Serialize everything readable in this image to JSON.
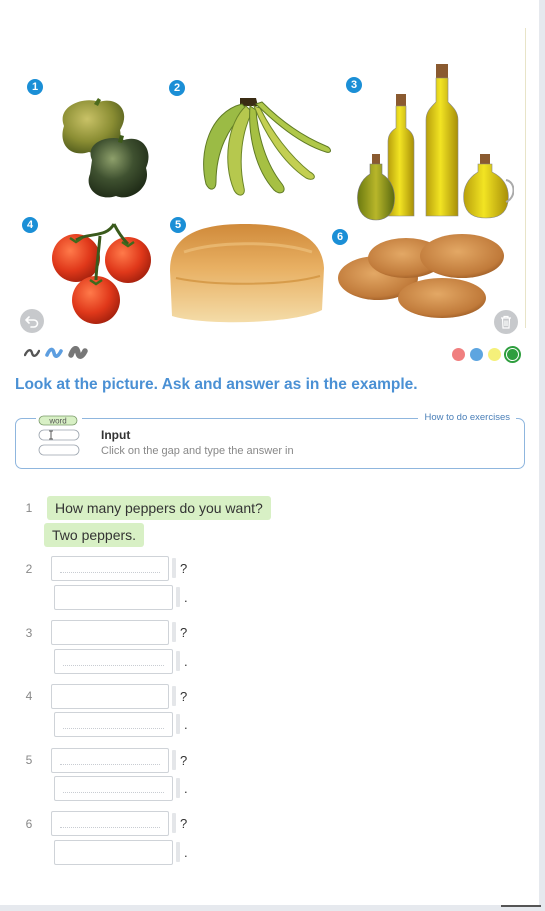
{
  "picture": {
    "badges": [
      "1",
      "2",
      "3",
      "4",
      "5",
      "6"
    ],
    "foods": [
      "peppers",
      "bananas",
      "oil",
      "tomatoes",
      "bread",
      "biscuits"
    ],
    "undo_icon": "undo-icon",
    "trash_icon": "trash-icon"
  },
  "toolbar": {
    "pens": [
      "thin-pen-icon",
      "marker-pen-icon",
      "eraser-icon"
    ],
    "colors": [
      "#f07f7f",
      "#5da5e0",
      "#f5f07a",
      "#2e9e3e"
    ],
    "selected_color": "#2e9e3e"
  },
  "instruction": "Look at the picture. Ask and answer as in the example.",
  "howto": {
    "link": "How to do exercises",
    "icon_word": "word",
    "title": "Input",
    "description": "Click on the gap and type the answer in"
  },
  "example": {
    "number": "1",
    "question": "How many peppers do you want?",
    "answer": "Two peppers."
  },
  "items": [
    {
      "number": "2",
      "question_value": "",
      "answer_value": "",
      "q_mark": "?",
      "a_mark": "."
    },
    {
      "number": "3",
      "question_value": "",
      "answer_value": "",
      "q_mark": "?",
      "a_mark": "."
    },
    {
      "number": "4",
      "question_value": "",
      "answer_value": "",
      "q_mark": "?",
      "a_mark": "."
    },
    {
      "number": "5",
      "question_value": "",
      "answer_value": "",
      "q_mark": "?",
      "a_mark": "."
    },
    {
      "number": "6",
      "question_value": "",
      "answer_value": "",
      "q_mark": "?",
      "a_mark": "."
    }
  ]
}
